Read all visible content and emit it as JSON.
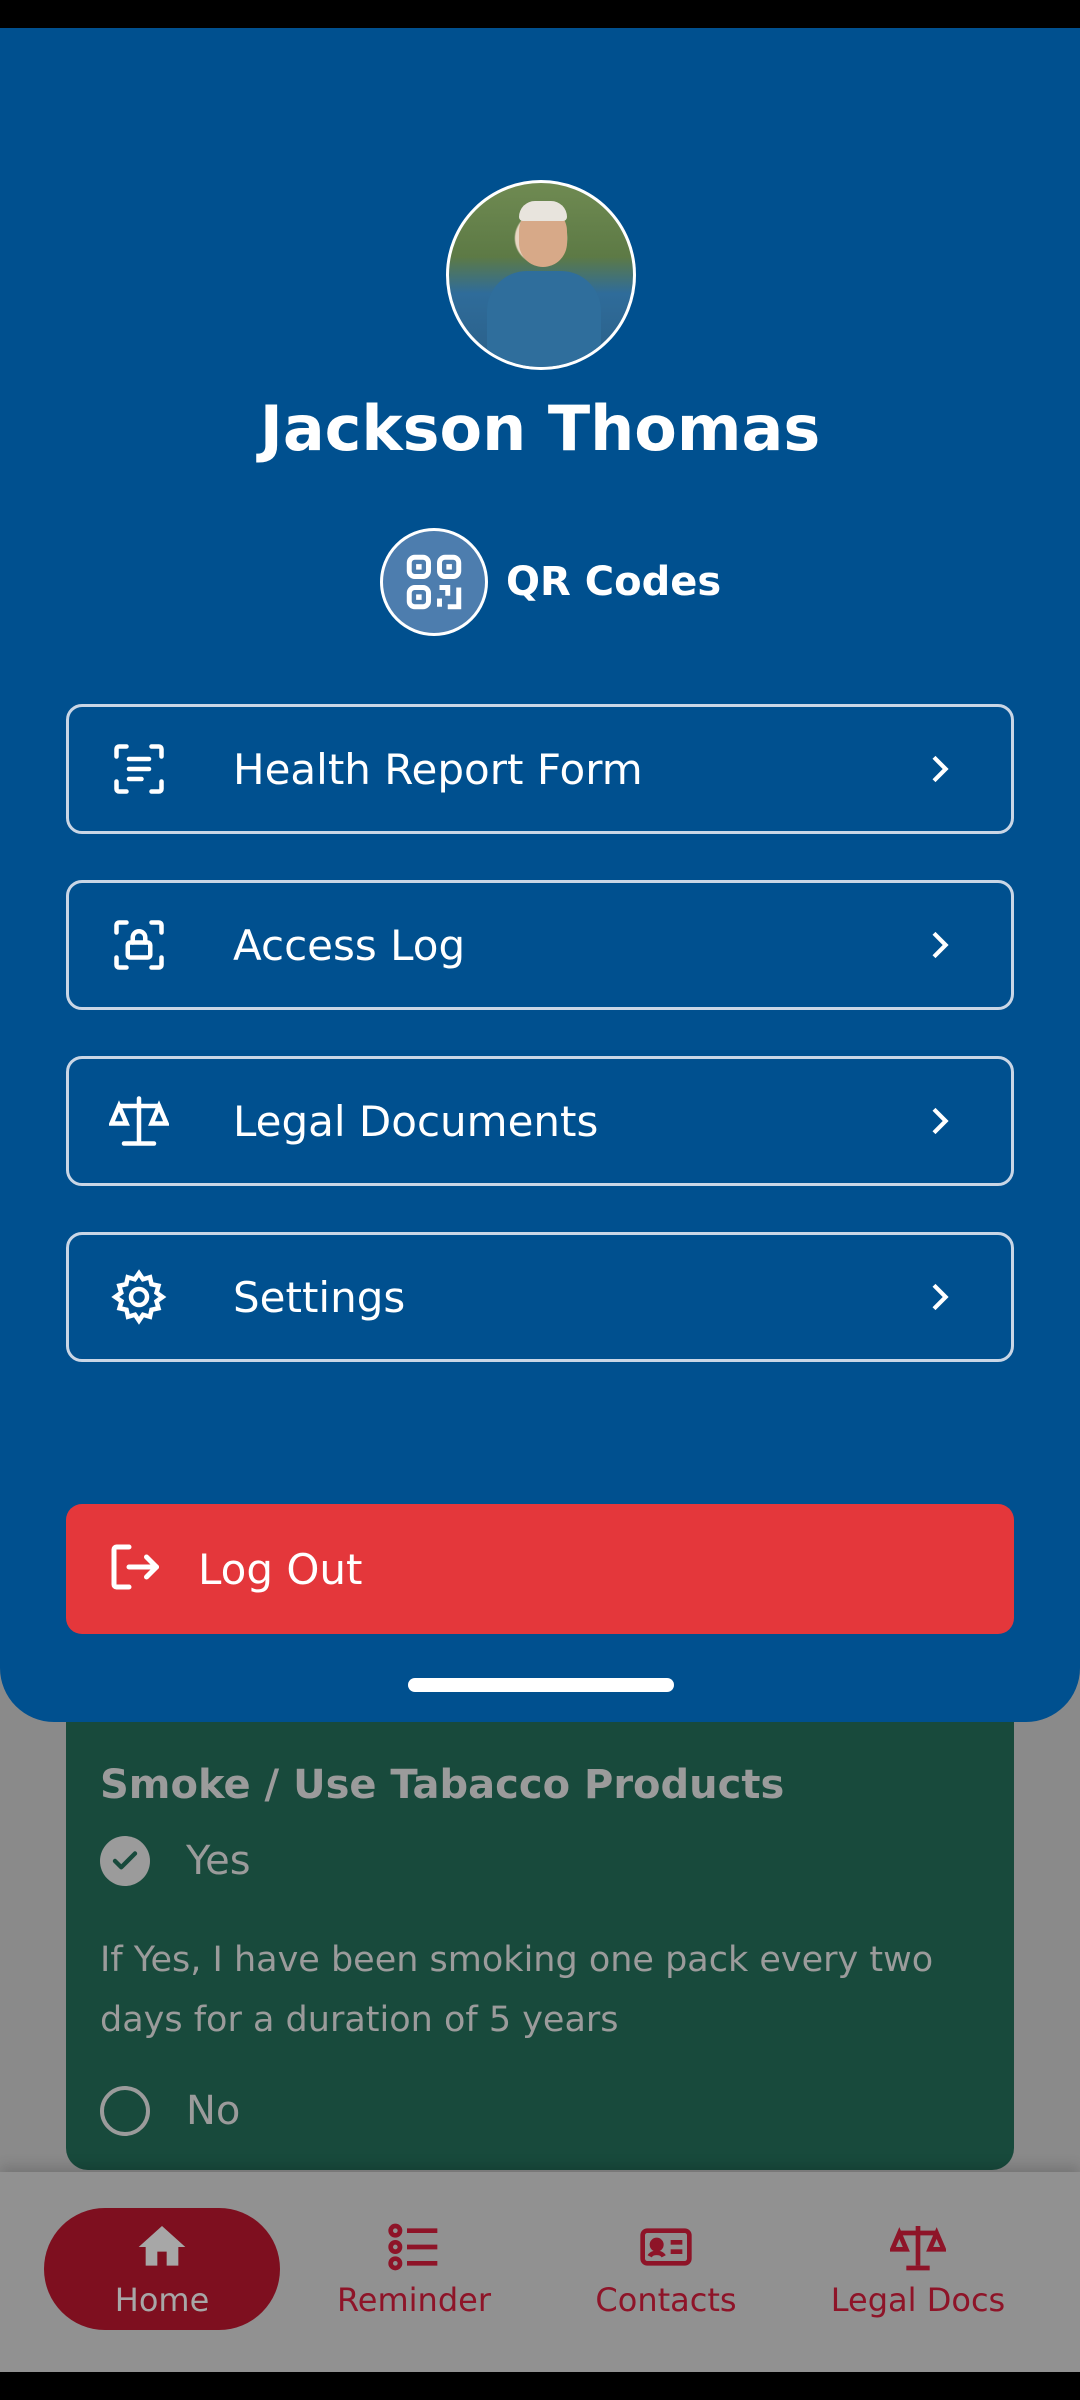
{
  "profile": {
    "name": "Jackson Thomas",
    "qr_label": "QR Codes"
  },
  "menu": [
    {
      "label": "Health Report Form",
      "icon": "document-scan-icon"
    },
    {
      "label": "Access Log",
      "icon": "lock-scan-icon"
    },
    {
      "label": "Legal Documents",
      "icon": "scales-icon"
    },
    {
      "label": "Settings",
      "icon": "gear-icon"
    }
  ],
  "logout": {
    "label": "Log Out"
  },
  "background_card": {
    "title": "Smoke / Use Tabacco Products",
    "yes_label": "Yes",
    "description": "If Yes, I have been smoking one pack every two days for a duration of 5 years",
    "no_label": "No"
  },
  "bottom_nav": [
    {
      "label": "Home",
      "icon": "home-icon",
      "active": true
    },
    {
      "label": "Reminder",
      "icon": "list-icon",
      "active": false
    },
    {
      "label": "Contacts",
      "icon": "contact-card-icon",
      "active": false
    },
    {
      "label": "Legal Docs",
      "icon": "scales-icon",
      "active": false
    }
  ],
  "colors": {
    "drawer_bg": "#00508f",
    "logout_bg": "#e4373b",
    "card_bg": "#184a3c",
    "nav_accent": "#8e1428"
  }
}
